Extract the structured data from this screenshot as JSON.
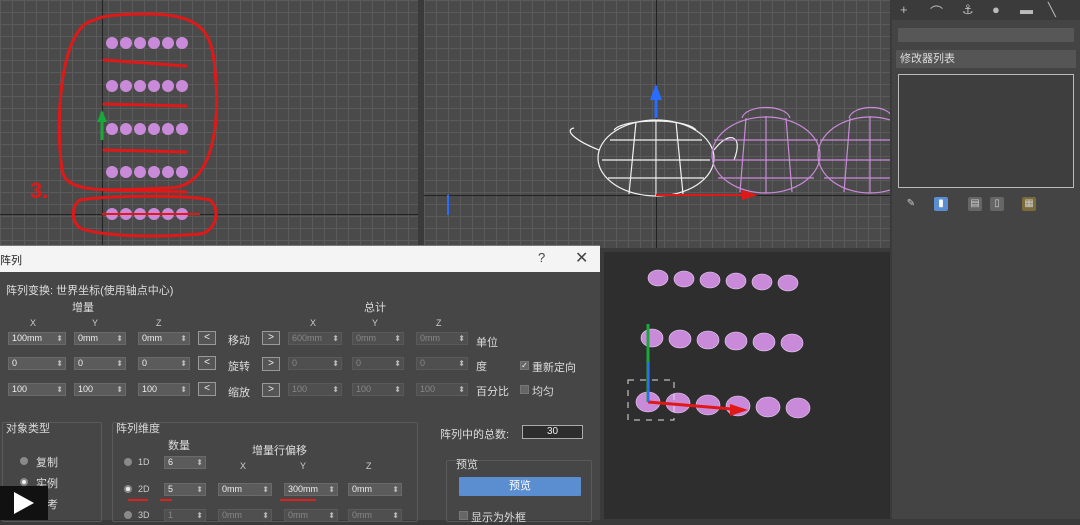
{
  "dialog": {
    "title": "阵列",
    "help": "?",
    "close": "✕",
    "transform_title": "阵列变换: 世界坐标(使用轴点中心)",
    "increment_label": "增量",
    "total_label": "总计",
    "axis_x": "X",
    "axis_y": "Y",
    "axis_z": "Z",
    "rows": [
      {
        "label": "移动",
        "inc": [
          "100mm",
          "0mm",
          "0mm"
        ],
        "tot": [
          "600mm",
          "0mm",
          "0mm"
        ],
        "unit": "单位"
      },
      {
        "label": "旋转",
        "inc": [
          "0",
          "0",
          "0"
        ],
        "tot": [
          "0",
          "0",
          "0"
        ],
        "unit": "度"
      },
      {
        "label": "缩放",
        "inc": [
          "100",
          "100",
          "100"
        ],
        "tot": [
          "100",
          "100",
          "100"
        ],
        "unit": "百分比"
      }
    ],
    "reorient_label": "重新定向",
    "uniform_label": "均匀",
    "object_type_title": "对象类型",
    "object_types": [
      "复制",
      "实例",
      "参考"
    ],
    "dimension_title": "阵列维度",
    "count_label": "数量",
    "row_offset_label": "增量行偏移",
    "dimensions": [
      {
        "name": "1D",
        "count": "6",
        "offsets": []
      },
      {
        "name": "2D",
        "count": "5",
        "offsets": [
          "0mm",
          "300mm",
          "0mm"
        ]
      },
      {
        "name": "3D",
        "count": "1",
        "offsets": [
          "0mm",
          "0mm",
          "0mm"
        ]
      }
    ],
    "total_count_label": "阵列中的总数:",
    "total_count": "30",
    "preview_title": "预览",
    "preview_button": "预览",
    "show_as_box": "显示为外框"
  },
  "panel": {
    "modifier_list": "修改器列表",
    "toolbar_icons": [
      "+",
      "⌒",
      "⚓",
      "●",
      "▬",
      "╲"
    ]
  },
  "viewport_annotation": "3.",
  "colors": {
    "teapot": "#c98bd9",
    "annotation_red": "#e01818",
    "accent_blue": "#5b8ed1"
  }
}
